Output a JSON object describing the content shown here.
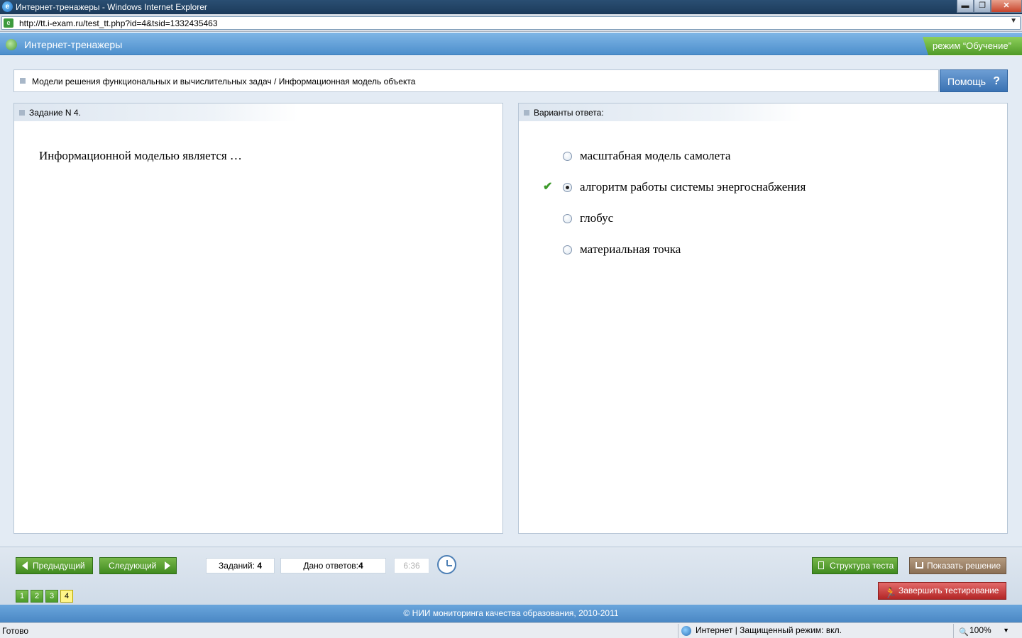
{
  "window": {
    "title": "Интернет-тренажеры - Windows Internet Explorer",
    "minimize": "▬",
    "restore": "❐",
    "close": "✕"
  },
  "address": {
    "url": "http://tt.i-exam.ru/test_tt.php?id=4&tsid=1332435463",
    "dropdown": "▼"
  },
  "app": {
    "title": "Интернет-тренажеры",
    "mode": "режим “Обучение”"
  },
  "breadcrumb": "Модели решения функциональных и вычислительных задач / Информационная модель объекта",
  "help": {
    "label": "Помощь",
    "icon": "?"
  },
  "task": {
    "header": "Задание N 4.",
    "question": "Информационной моделью является …"
  },
  "answers": {
    "header": "Варианты ответа:",
    "options": [
      {
        "text": "масштабная модель самолета",
        "selected": false
      },
      {
        "text": "алгоритм работы системы энергоснабжения",
        "selected": true,
        "correct_mark": "✔"
      },
      {
        "text": "глобус",
        "selected": false
      },
      {
        "text": "материальная точка",
        "selected": false
      }
    ]
  },
  "nav": {
    "prev": "Предыдущий",
    "next": "Следующий",
    "tasks_label": "Заданий:",
    "tasks_count": "4",
    "answers_label": "Дано ответов:",
    "answers_count": "4",
    "timer": "6:36",
    "pages": [
      "1",
      "2",
      "3",
      "4"
    ],
    "current_page": "4"
  },
  "actions": {
    "structure": "Структура теста",
    "show_solution": "Показать решение",
    "finish": "Завершить тестирование",
    "finish_icon": "🏃"
  },
  "footer": "© НИИ мониторинга качества образования, 2010-2011",
  "status": {
    "ready": "Готово",
    "zone": "Интернет | Защищенный режим: вкл.",
    "zoom": "100%",
    "zoom_icon": "🔍",
    "zoom_dropdown": "▼"
  },
  "colors": {
    "header_blue": "#4d8fcc",
    "mode_green": "#4f9a27",
    "button_green": "#3f8a1f",
    "finish_red": "#b32626",
    "current_page_yellow": "#fff58a"
  }
}
